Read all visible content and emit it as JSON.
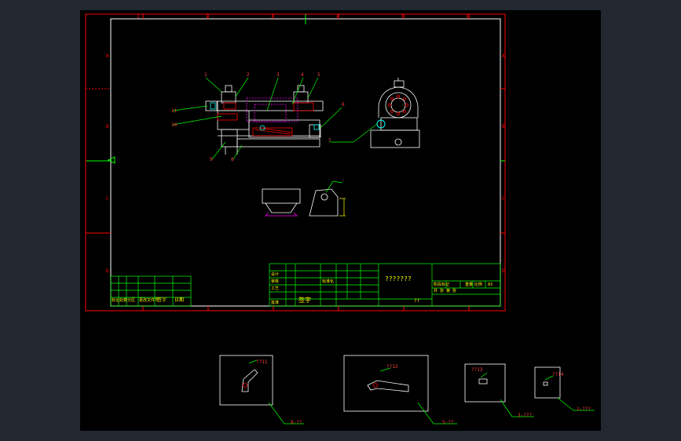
{
  "colors": {
    "background": "#212830",
    "canvas": "#000000",
    "border": "#ff0000",
    "geometry": "#ffffff",
    "table": "#00ff00",
    "leader": "#00ff00",
    "balloon_text": "#ff4040",
    "title_text": "#ffff00",
    "hidden_line": "#ff00ff",
    "dimension": "#ffff00",
    "cyan": "#00ffff"
  },
  "border": {
    "top_zones": [
      "1",
      "2",
      "3",
      "4",
      "5",
      "6"
    ],
    "side_zones": [
      "A",
      "B",
      "C",
      "D"
    ]
  },
  "balloons": [
    "1",
    "2",
    "3",
    "4",
    "5",
    "6",
    "7",
    "8",
    "9",
    "10",
    "11"
  ],
  "title_block": {
    "drawing_title": "???????",
    "scale_label": "??",
    "signature_label": "签字",
    "date_label": "日期",
    "sign_label": "签字",
    "rev_labels": [
      "标记",
      "处数",
      "分区",
      "更改文件号"
    ],
    "design_label": "设计",
    "review_label": "审核",
    "process_label": "工艺",
    "approve_label": "批准",
    "std_label": "标准化",
    "stage_label": "阶段标记",
    "weight_label": "重量",
    "ratio_label": "比例",
    "sheet_label": "共 张 第 张",
    "ratio_value": "A3"
  },
  "details": [
    {
      "id": "detail-1",
      "leader_label": "8-??",
      "note": "??11"
    },
    {
      "id": "detail-2",
      "leader_label": "5-??",
      "note": "??12"
    },
    {
      "id": "detail-3",
      "leader_label": "3-???",
      "note": "??13"
    },
    {
      "id": "detail-4",
      "leader_label": "1-???",
      "note": "??14"
    }
  ]
}
